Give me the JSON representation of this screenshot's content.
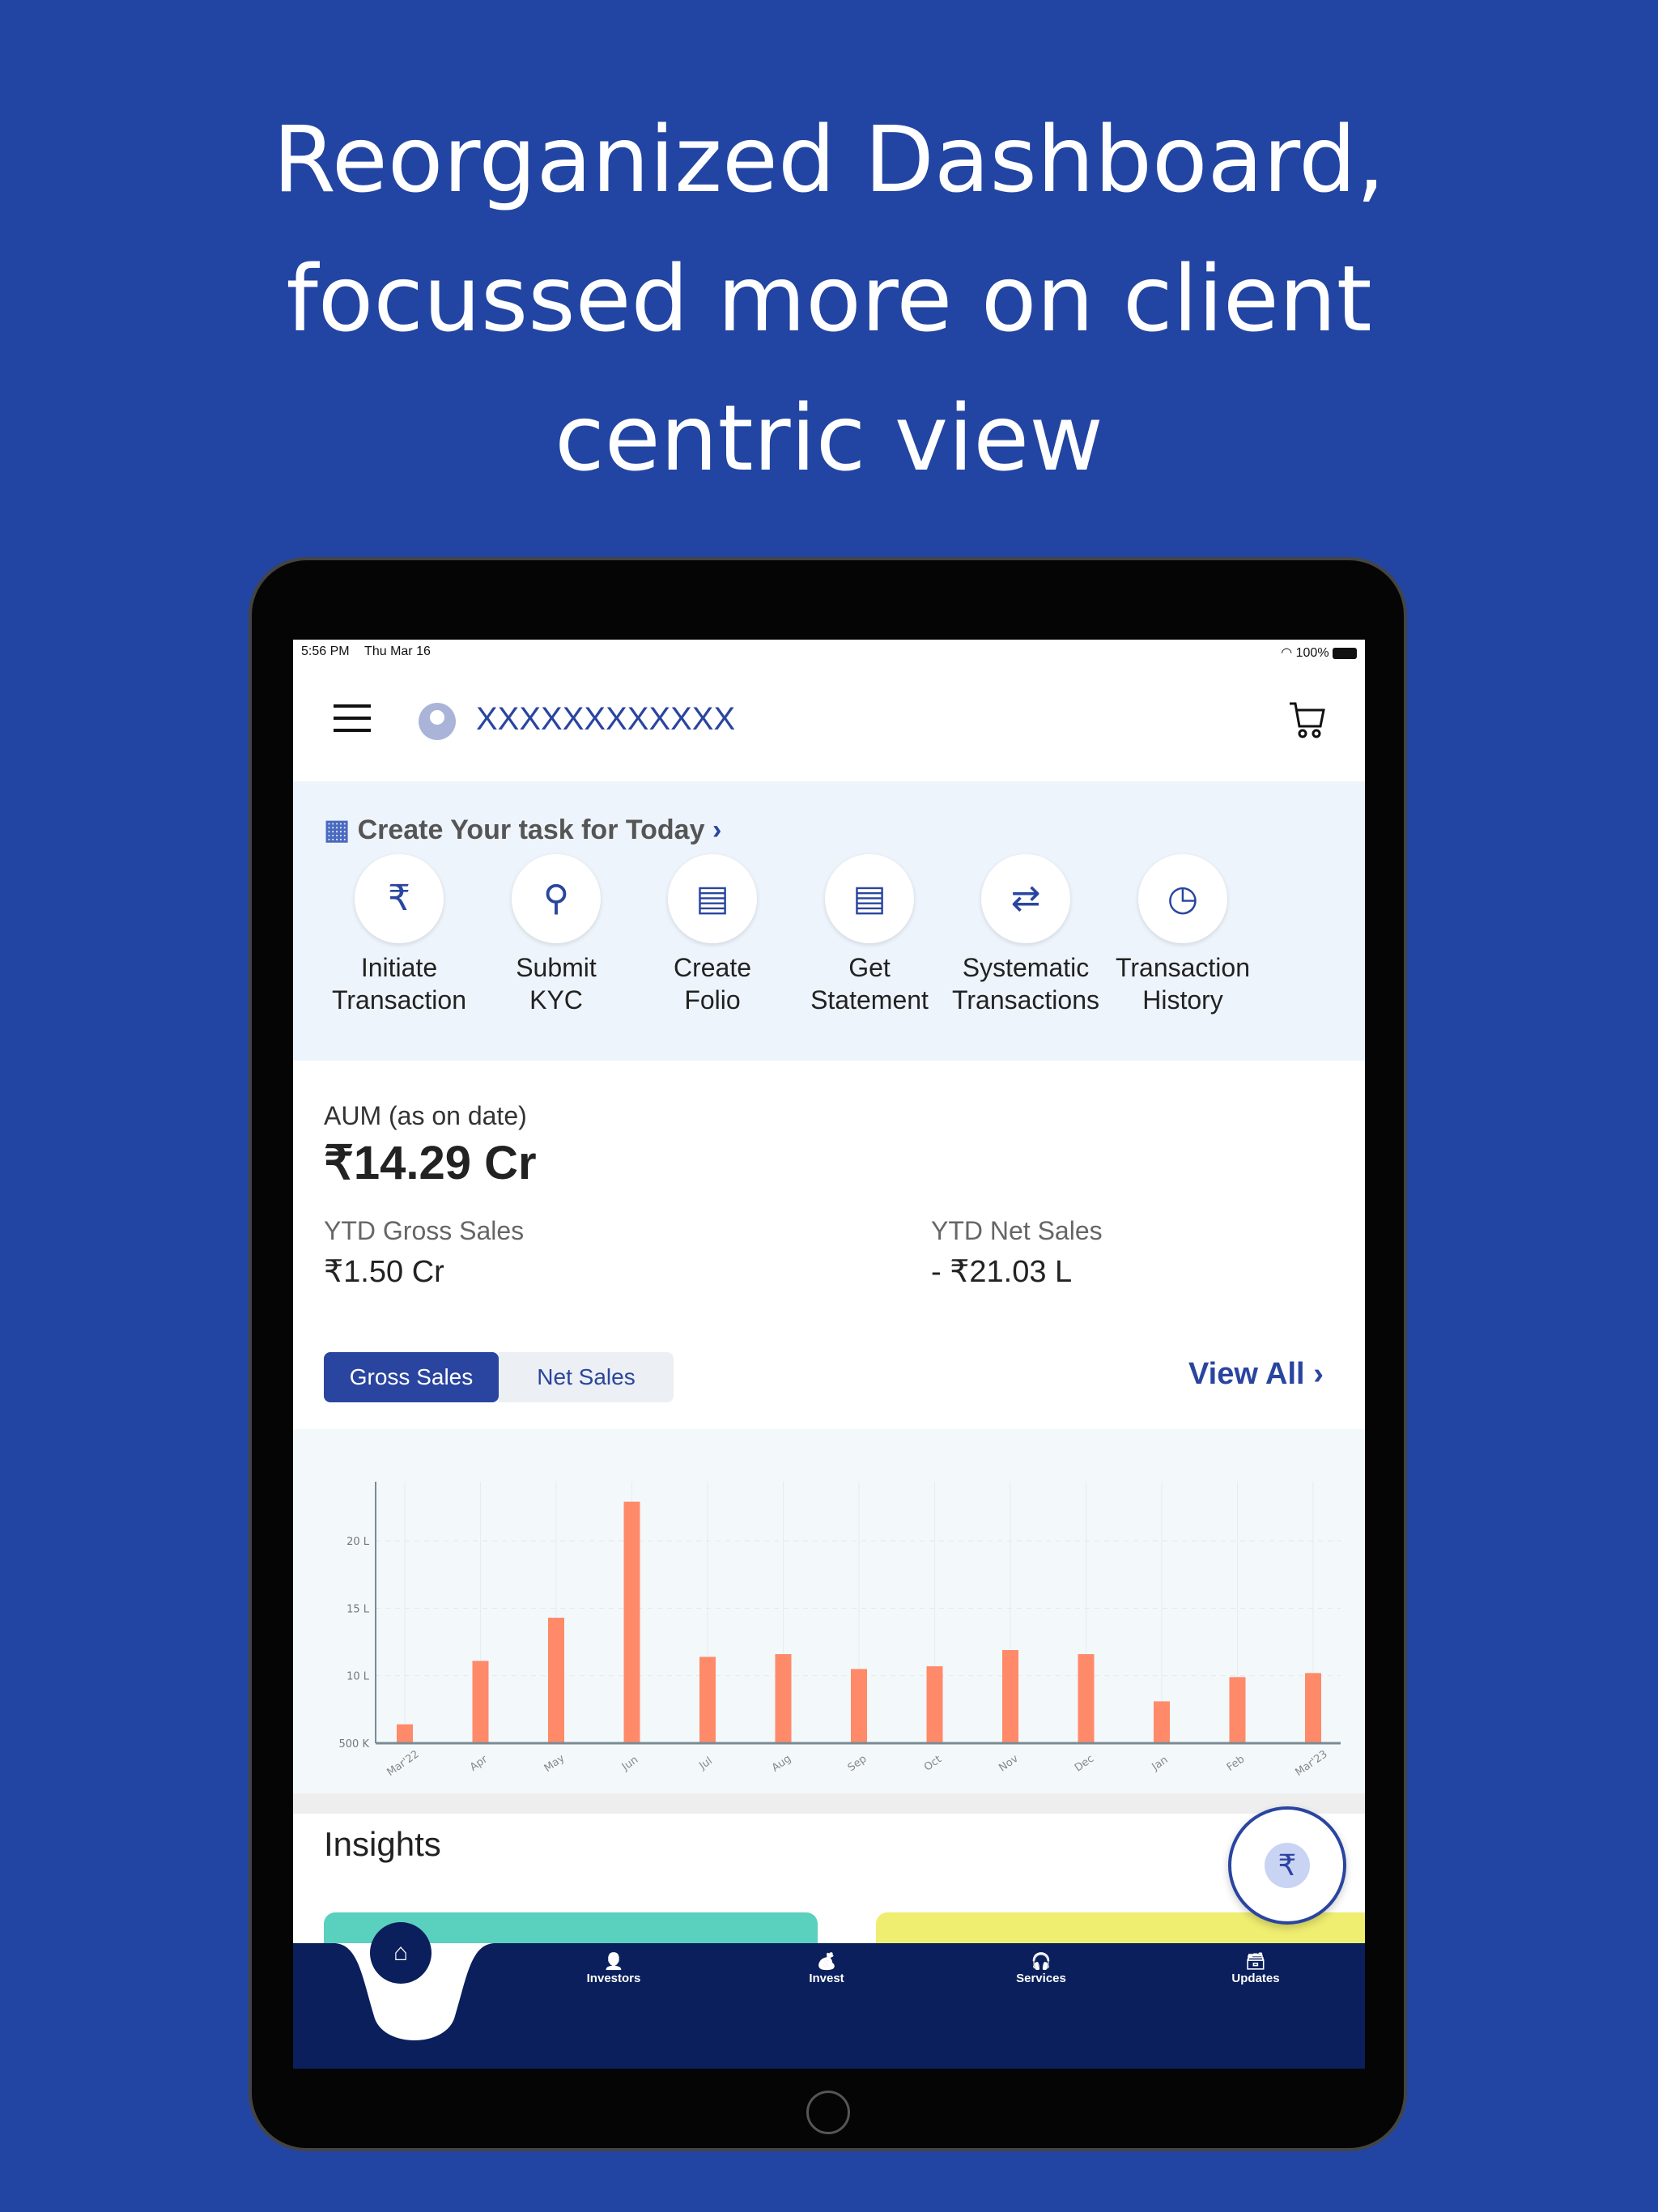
{
  "headline": {
    "line1": "Reorganized Dashboard,",
    "line2": "focussed more on client",
    "line3": "centric view"
  },
  "status_bar": {
    "time": "5:56 PM",
    "date": "Thu Mar 16",
    "battery": "100%"
  },
  "header": {
    "user_name": "XXXXXXXXXXXX"
  },
  "tasks": {
    "title": "Create Your task for Today",
    "items": [
      {
        "line1": "Initiate",
        "line2": "Transaction",
        "icon": "rupee-cycle-icon"
      },
      {
        "line1": "Submit",
        "line2": "KYC",
        "icon": "user-search-icon"
      },
      {
        "line1": "Create",
        "line2": "Folio",
        "icon": "document-plus-icon"
      },
      {
        "line1": "Get",
        "line2": "Statement",
        "icon": "document-plus-icon"
      },
      {
        "line1": "Systematic",
        "line2": "Transactions",
        "icon": "document-transfer-icon"
      },
      {
        "line1": "Transaction",
        "line2": "History",
        "icon": "document-clock-icon"
      }
    ]
  },
  "summary": {
    "aum_label": "AUM (as on date)",
    "aum_value": "₹14.29 Cr",
    "gross_label": "YTD Gross Sales",
    "gross_value": "₹1.50 Cr",
    "net_label": "YTD Net Sales",
    "net_value": "- ₹21.03 L"
  },
  "chart_tabs": {
    "gross": "Gross Sales",
    "net": "Net Sales",
    "active": "Gross Sales",
    "view_all": "View All"
  },
  "chart_data": {
    "type": "bar",
    "categories": [
      "Mar'22",
      "Apr",
      "May",
      "Jun",
      "Jul",
      "Aug",
      "Sep",
      "Oct",
      "Nov",
      "Dec",
      "Jan",
      "Feb",
      "Mar'23"
    ],
    "values": [
      6.4,
      11.1,
      14.3,
      22.9,
      11.4,
      11.6,
      10.5,
      10.7,
      11.9,
      11.6,
      8.1,
      9.9,
      10.2
    ],
    "unit": "L",
    "yticks": [
      5,
      10,
      15,
      20
    ],
    "ytick_labels": [
      "500 K",
      "10 L",
      "15 L",
      "20 L"
    ],
    "ylim": [
      5,
      24
    ],
    "bar_color": "#ff8a6a",
    "grid": true
  },
  "insights": {
    "title": "Insights",
    "card_colors": [
      "#5ad0bf",
      "#f0ee70"
    ]
  },
  "bottom_nav": {
    "items": [
      {
        "label": "Investors"
      },
      {
        "label": "Invest"
      },
      {
        "label": "Services"
      },
      {
        "label": "Updates"
      }
    ]
  },
  "colors": {
    "background": "#2245a3",
    "accent": "#2a45a0",
    "nav": "#0a1f5c"
  }
}
